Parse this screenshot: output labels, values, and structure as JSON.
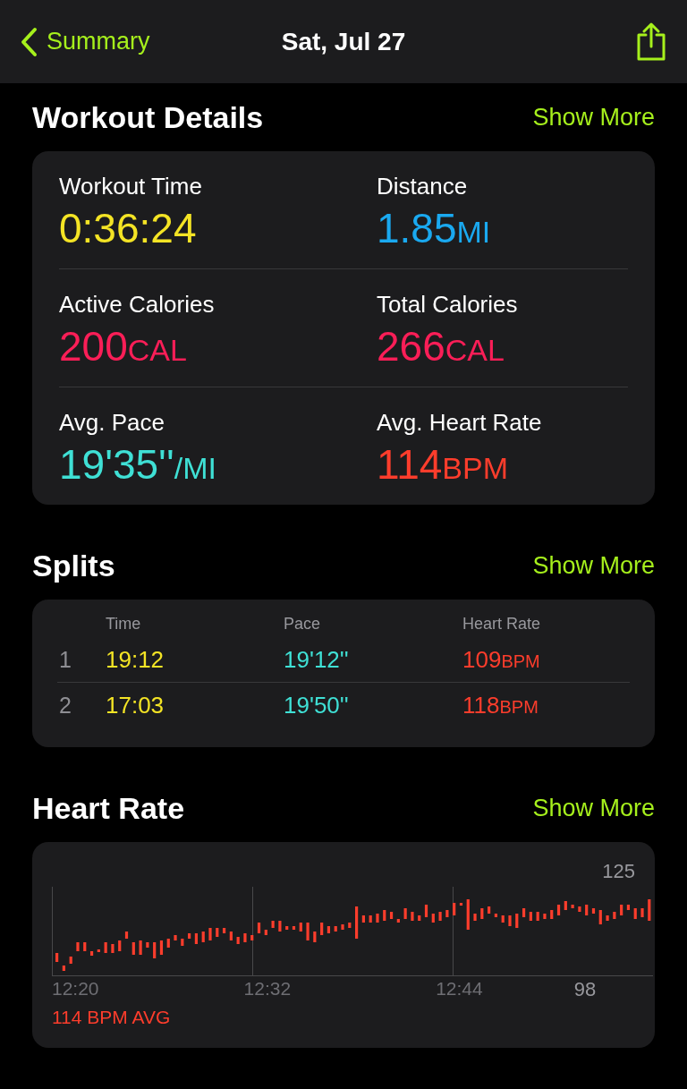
{
  "nav": {
    "back": "Summary",
    "title": "Sat, Jul 27"
  },
  "details": {
    "title": "Workout Details",
    "more": "Show More",
    "metrics": [
      {
        "label": "Workout Time",
        "value": "0:36:24",
        "color": "#f4e425"
      },
      {
        "label": "Distance",
        "value": "1.85",
        "unit": "MI",
        "color": "#1aa9f0"
      },
      {
        "label": "Active Calories",
        "value": "200",
        "unit": "CAL",
        "color": "#fa1e57"
      },
      {
        "label": "Total Calories",
        "value": "266",
        "unit": "CAL",
        "color": "#fa1e57"
      },
      {
        "label": "Avg. Pace",
        "value": "19'35''",
        "unit": "/MI",
        "color": "#3fe0d5"
      },
      {
        "label": "Avg. Heart Rate",
        "value": "114",
        "unit": "BPM",
        "color": "#fd3d2c"
      }
    ]
  },
  "splits": {
    "title": "Splits",
    "more": "Show More",
    "columns": [
      {
        "label": "Time",
        "color": "#f4e425"
      },
      {
        "label": "Pace",
        "color": "#3fe0d5"
      },
      {
        "label": "Heart Rate",
        "color": "#fd3d2c"
      }
    ],
    "rows": [
      {
        "index": "1",
        "cells": [
          {
            "value": "19:12"
          },
          {
            "value": "19'12''"
          },
          {
            "value": "109",
            "unit": "BPM"
          }
        ]
      },
      {
        "index": "2",
        "cells": [
          {
            "value": "17:03"
          },
          {
            "value": "19'50''"
          },
          {
            "value": "118",
            "unit": "BPM"
          }
        ]
      }
    ]
  },
  "heart_rate": {
    "title": "Heart Rate",
    "more": "Show More",
    "max_label": "125",
    "min_label": "98",
    "x_labels": [
      "12:20",
      "12:32",
      "12:44"
    ],
    "average": "114 BPM AVG"
  }
}
